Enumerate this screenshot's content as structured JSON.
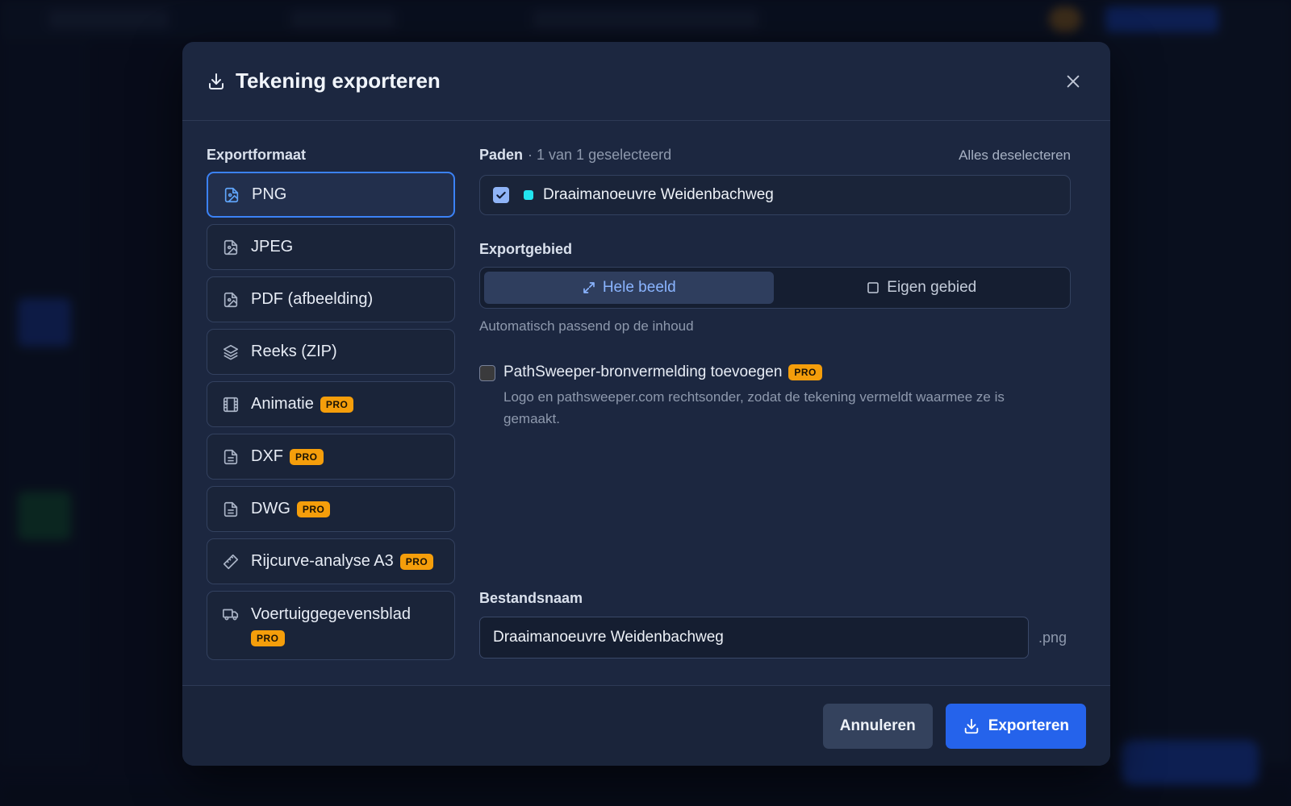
{
  "dialog": {
    "title": "Tekening exporteren",
    "title_icon": "download-icon",
    "close_icon": "close-icon"
  },
  "formats": {
    "label": "Exportformaat",
    "pro_badge": "PRO",
    "items": [
      {
        "label": "PNG",
        "icon": "image-file-icon",
        "pro": false,
        "selected": true
      },
      {
        "label": "JPEG",
        "icon": "image-file-icon",
        "pro": false,
        "selected": false
      },
      {
        "label": "PDF (afbeelding)",
        "icon": "image-file-icon",
        "pro": false,
        "selected": false
      },
      {
        "label": "Reeks (ZIP)",
        "icon": "layers-icon",
        "pro": false,
        "selected": false
      },
      {
        "label": "Animatie",
        "icon": "film-icon",
        "pro": true,
        "selected": false
      },
      {
        "label": "DXF",
        "icon": "document-icon",
        "pro": true,
        "selected": false
      },
      {
        "label": "DWG",
        "icon": "document-icon",
        "pro": true,
        "selected": false
      },
      {
        "label": "Rijcurve-analyse A3",
        "icon": "ruler-icon",
        "pro": true,
        "selected": false
      },
      {
        "label": "Voertuiggegevensblad",
        "icon": "truck-icon",
        "pro": true,
        "selected": false
      }
    ]
  },
  "paths": {
    "title": "Paden",
    "subtitle": "· 1 van 1 geselecteerd",
    "deselect_all": "Alles deselecteren",
    "items": [
      {
        "name": "Draaimanoeuvre Weidenbachweg",
        "checked": true,
        "color": "#22e5f0"
      }
    ]
  },
  "export_area": {
    "label": "Exportgebied",
    "options": [
      {
        "label": "Hele beeld",
        "icon": "expand-icon",
        "active": true
      },
      {
        "label": "Eigen gebied",
        "icon": "square-icon",
        "active": false
      }
    ],
    "hint": "Automatisch passend op de inhoud"
  },
  "attribution": {
    "checked": false,
    "label": "PathSweeper-bronvermelding toevoegen",
    "badge": "PRO",
    "description": "Logo en pathsweeper.com rechtsonder, zodat de tekening vermeldt waarmee ze is gemaakt."
  },
  "filename": {
    "label": "Bestandsnaam",
    "value": "Draaimanoeuvre Weidenbachweg",
    "extension": ".png"
  },
  "footer": {
    "cancel_label": "Annuleren",
    "export_label": "Exporteren"
  },
  "colors": {
    "accent": "#3b82f6",
    "primary_button": "#2563eb",
    "pro_badge": "#f59e0b",
    "modal_bg": "#1c2740"
  }
}
